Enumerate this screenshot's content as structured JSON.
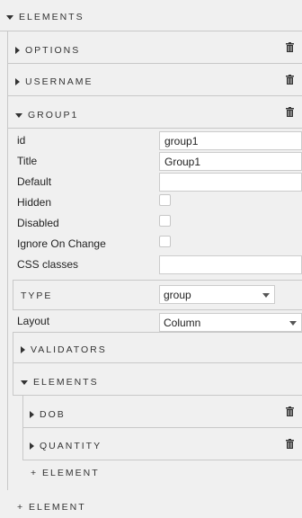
{
  "root": {
    "label": "ELEMENTS",
    "add_label": "+ ELEMENT"
  },
  "collapsed_sections": [
    {
      "label": "OPTIONS"
    },
    {
      "label": "USERNAME"
    }
  ],
  "group": {
    "label": "GROUP1",
    "fields": {
      "id": {
        "label": "id",
        "value": "group1"
      },
      "title": {
        "label": "Title",
        "value": "Group1"
      },
      "default": {
        "label": "Default",
        "value": ""
      },
      "hidden": {
        "label": "Hidden",
        "checked": false
      },
      "disabled": {
        "label": "Disabled",
        "checked": false
      },
      "ignore_on_change": {
        "label": "Ignore On Change",
        "checked": false
      },
      "css_classes": {
        "label": "CSS classes",
        "value": ""
      }
    },
    "type": {
      "label": "TYPE",
      "selected": "group"
    },
    "layout": {
      "label": "Layout",
      "selected": "Column"
    },
    "validators": {
      "label": "VALIDATORS"
    },
    "elements": {
      "label": "ELEMENTS",
      "items": [
        {
          "label": "DOB"
        },
        {
          "label": "QUANTITY"
        }
      ],
      "add_label": "+ ELEMENT"
    }
  },
  "icons": {
    "trash": "trash-icon",
    "expand": "caret-right-icon",
    "collapse": "caret-down-icon",
    "dropdown": "dropdown-caret-icon"
  },
  "colors": {
    "background": "#f0f0f0",
    "border": "#c8c8c8",
    "text": "#333333",
    "input_bg": "#ffffff"
  }
}
